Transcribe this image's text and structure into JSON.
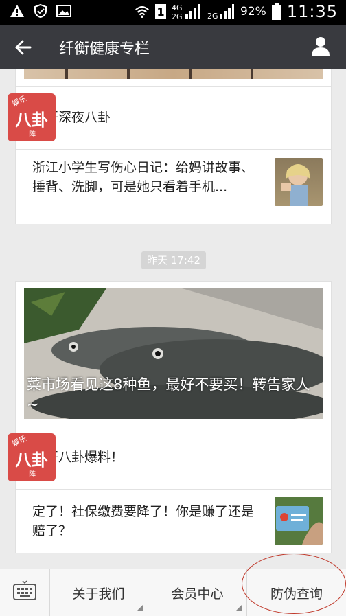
{
  "status_bar": {
    "battery": "92%",
    "time": "11:35",
    "sim_slot": "1"
  },
  "app_bar": {
    "title": "纤衡健康专栏"
  },
  "first_card": {
    "items": [
      {
        "title": "腿哥深夜八卦",
        "thumb": {
          "top": "娱乐",
          "main": "八卦",
          "bottom": "阵"
        }
      },
      {
        "title": "浙江小学生写伤心日记：给妈讲故事、捶背、洗脚，可是她只看着手机..."
      }
    ]
  },
  "timestamp": "昨天 17:42",
  "second_card": {
    "hero_caption": "菜市场看见这8种鱼，最好不要买！转告家人~",
    "items": [
      {
        "title": "腿哥八卦爆料！",
        "thumb": {
          "top": "娱乐",
          "main": "八卦",
          "bottom": "阵"
        }
      },
      {
        "title": "定了！社保缴费要降了！你是赚了还是赔了？"
      }
    ]
  },
  "bottom_menu": [
    "关于我们",
    "会员中心",
    "防伪查询"
  ]
}
